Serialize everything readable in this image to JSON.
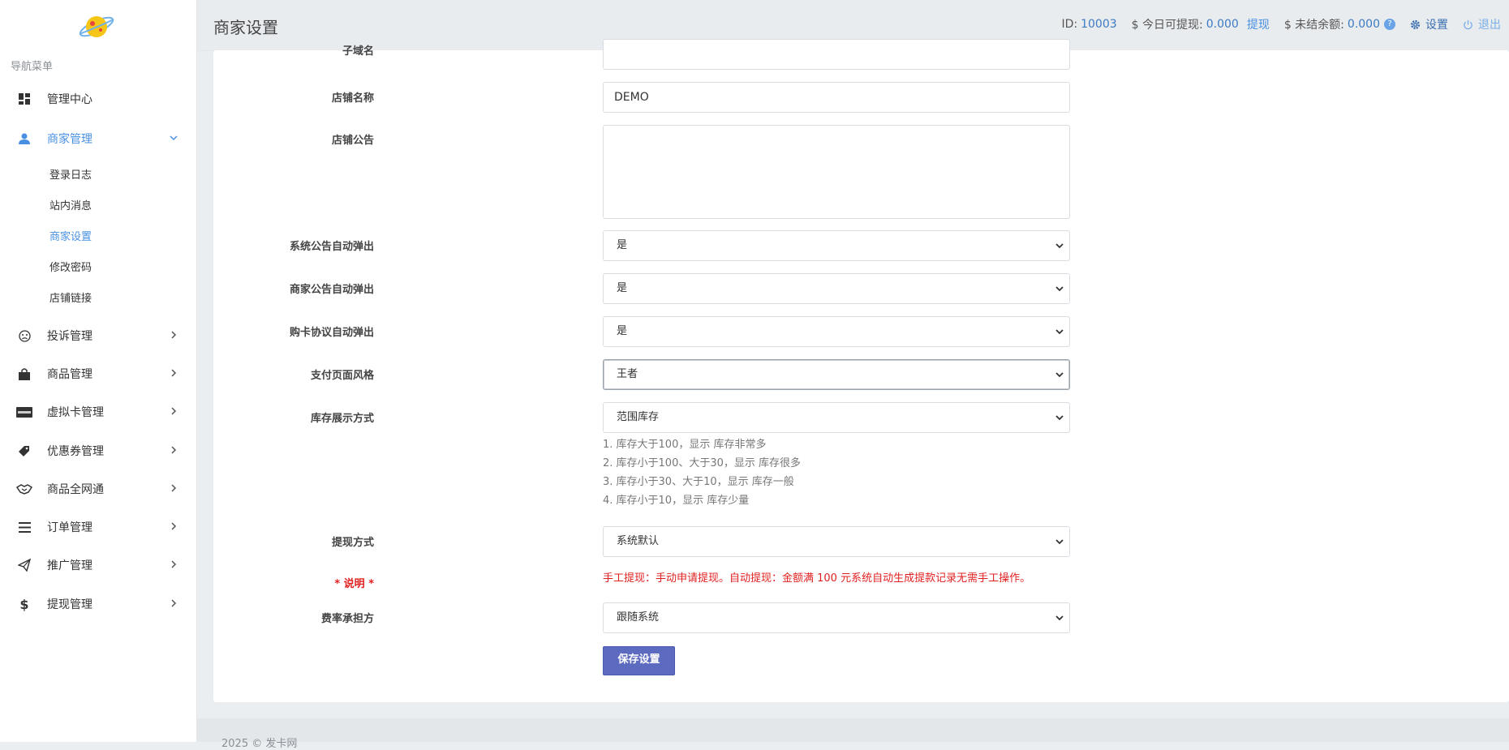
{
  "sidebar": {
    "heading": "导航菜单",
    "items": [
      {
        "label": "管理中心",
        "icon": "dashboard-icon"
      },
      {
        "label": "商家管理",
        "icon": "user-icon",
        "active": true
      },
      {
        "label": "投诉管理",
        "icon": "frown-icon"
      },
      {
        "label": "商品管理",
        "icon": "shopping-bag-icon"
      },
      {
        "label": "虚拟卡管理",
        "icon": "card-icon"
      },
      {
        "label": "优惠券管理",
        "icon": "tag-icon"
      },
      {
        "label": "商品全网通",
        "icon": "handshake-icon"
      },
      {
        "label": "订单管理",
        "icon": "list-icon"
      },
      {
        "label": "推广管理",
        "icon": "paper-plane-icon"
      },
      {
        "label": "提现管理",
        "icon": "dollar-icon"
      }
    ],
    "subitems": [
      {
        "label": "登录日志"
      },
      {
        "label": "站内消息"
      },
      {
        "label": "商家设置",
        "active": true
      },
      {
        "label": "修改密码"
      },
      {
        "label": "店铺链接"
      }
    ]
  },
  "header": {
    "title": "商家设置",
    "id_label": "ID:",
    "id_value": "10003",
    "withdrawable_label": "$ 今日可提现:",
    "withdrawable_value": "0.000",
    "withdraw_link": "提现",
    "unsettled_label": "$ 未结余额:",
    "unsettled_value": "0.000",
    "help_badge": "?",
    "settings_label": "设置",
    "logout_label": "退出"
  },
  "form": {
    "subdomain_label": "子域名",
    "subdomain_value": "",
    "shop_name_label": "店铺名称",
    "shop_name_value": "DEMO",
    "shop_notice_label": "店铺公告",
    "shop_notice_value": "",
    "sys_popup_label": "系统公告自动弹出",
    "sys_popup_value": "是",
    "merchant_popup_label": "商家公告自动弹出",
    "merchant_popup_value": "是",
    "agreement_popup_label": "购卡协议自动弹出",
    "agreement_popup_value": "是",
    "pay_style_label": "支付页面风格",
    "pay_style_value": "王者",
    "stock_display_label": "库存展示方式",
    "stock_display_value": "范围库存",
    "stock_hints": [
      "1. 库存大于100，显示 库存非常多",
      "2. 库存小于100、大于30，显示 库存很多",
      "3. 库存小于30、大于10，显示 库存一般",
      "4. 库存小于10，显示 库存少量"
    ],
    "withdraw_method_label": "提现方式",
    "withdraw_method_value": "系统默认",
    "note_label": "* 说明 *",
    "note_text": "手工提现：手动申请提现。自动提现：金额满 100 元系统自动生成提款记录无需手工操作。",
    "fee_bearer_label": "费率承担方",
    "fee_bearer_value": "跟随系统",
    "save_button": "保存设置"
  },
  "footer": {
    "text": "2025 © 发卡网"
  },
  "colors": {
    "accent": "#4a90e2",
    "button": "#5c6bc0",
    "warning": "#e02020"
  }
}
